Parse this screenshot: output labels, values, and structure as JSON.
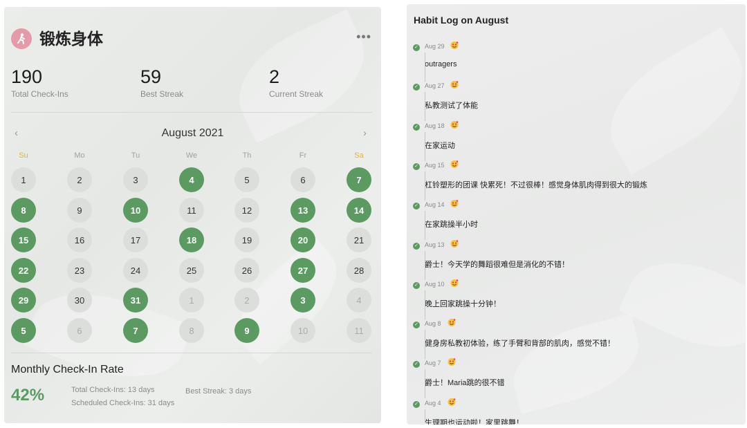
{
  "habit": {
    "title": "锻炼身体",
    "icon": "person-exercise-icon"
  },
  "stats": [
    {
      "value": "190",
      "label": "Total Check-Ins"
    },
    {
      "value": "59",
      "label": "Best Streak"
    },
    {
      "value": "2",
      "label": "Current Streak"
    }
  ],
  "calendar": {
    "month_label": "August 2021",
    "weekdays": [
      "Su",
      "Mo",
      "Tu",
      "We",
      "Th",
      "Fr",
      "Sa"
    ],
    "weeks": [
      [
        {
          "d": "1",
          "done": false,
          "other": false
        },
        {
          "d": "2",
          "done": false,
          "other": false
        },
        {
          "d": "3",
          "done": false,
          "other": false
        },
        {
          "d": "4",
          "done": true,
          "other": false
        },
        {
          "d": "5",
          "done": false,
          "other": false
        },
        {
          "d": "6",
          "done": false,
          "other": false
        },
        {
          "d": "7",
          "done": true,
          "other": false
        }
      ],
      [
        {
          "d": "8",
          "done": true,
          "other": false
        },
        {
          "d": "9",
          "done": false,
          "other": false
        },
        {
          "d": "10",
          "done": true,
          "other": false
        },
        {
          "d": "11",
          "done": false,
          "other": false
        },
        {
          "d": "12",
          "done": false,
          "other": false
        },
        {
          "d": "13",
          "done": true,
          "other": false
        },
        {
          "d": "14",
          "done": true,
          "other": false
        }
      ],
      [
        {
          "d": "15",
          "done": true,
          "other": false
        },
        {
          "d": "16",
          "done": false,
          "other": false
        },
        {
          "d": "17",
          "done": false,
          "other": false
        },
        {
          "d": "18",
          "done": true,
          "other": false
        },
        {
          "d": "19",
          "done": false,
          "other": false
        },
        {
          "d": "20",
          "done": true,
          "other": false
        },
        {
          "d": "21",
          "done": false,
          "other": false
        }
      ],
      [
        {
          "d": "22",
          "done": true,
          "other": false
        },
        {
          "d": "23",
          "done": false,
          "other": false
        },
        {
          "d": "24",
          "done": false,
          "other": false
        },
        {
          "d": "25",
          "done": false,
          "other": false
        },
        {
          "d": "26",
          "done": false,
          "other": false
        },
        {
          "d": "27",
          "done": true,
          "other": false
        },
        {
          "d": "28",
          "done": false,
          "other": false
        }
      ],
      [
        {
          "d": "29",
          "done": true,
          "other": false
        },
        {
          "d": "30",
          "done": false,
          "other": false
        },
        {
          "d": "31",
          "done": true,
          "other": false
        },
        {
          "d": "1",
          "done": false,
          "other": true
        },
        {
          "d": "2",
          "done": false,
          "other": true
        },
        {
          "d": "3",
          "done": true,
          "other": true
        },
        {
          "d": "4",
          "done": false,
          "other": true
        }
      ],
      [
        {
          "d": "5",
          "done": true,
          "other": true
        },
        {
          "d": "6",
          "done": false,
          "other": true
        },
        {
          "d": "7",
          "done": true,
          "other": true
        },
        {
          "d": "8",
          "done": false,
          "other": true
        },
        {
          "d": "9",
          "done": true,
          "other": true
        },
        {
          "d": "10",
          "done": false,
          "other": true
        },
        {
          "d": "11",
          "done": false,
          "other": true
        }
      ]
    ]
  },
  "monthly_rate": {
    "title": "Monthly Check-In Rate",
    "percent": "42%",
    "total": "Total Check-Ins: 13 days",
    "scheduled": "Scheduled Check-Ins: 31 days",
    "best": "Best Streak: 3 days"
  },
  "log": {
    "title": "Habit Log on August",
    "entries": [
      {
        "date": "Aug 29",
        "text": "outragers"
      },
      {
        "date": "Aug 27",
        "text": "私教测试了体能"
      },
      {
        "date": "Aug 18",
        "text": "在家运动"
      },
      {
        "date": "Aug 15",
        "text": "杠铃塑形的团课 快累死！不过很棒！感觉身体肌肉得到很大的锻炼"
      },
      {
        "date": "Aug 14",
        "text": "在家跳操半小时"
      },
      {
        "date": "Aug 13",
        "text": "爵士！今天学的舞蹈很难但是消化的不错！"
      },
      {
        "date": "Aug 10",
        "text": "晚上回家跳操十分钟！"
      },
      {
        "date": "Aug 8",
        "text": "健身房私教初体验，练了手臂和背部的肌肉，感觉不错！"
      },
      {
        "date": "Aug 7",
        "text": "爵士！Maria跳的很不错"
      },
      {
        "date": "Aug 4",
        "text": "生理期也运动啦！家里跳舞！"
      }
    ]
  },
  "colors": {
    "check_green": "#5b9a61",
    "weekend_yellow": "#e6b22e",
    "avatar_pink": "#e49aa8"
  }
}
